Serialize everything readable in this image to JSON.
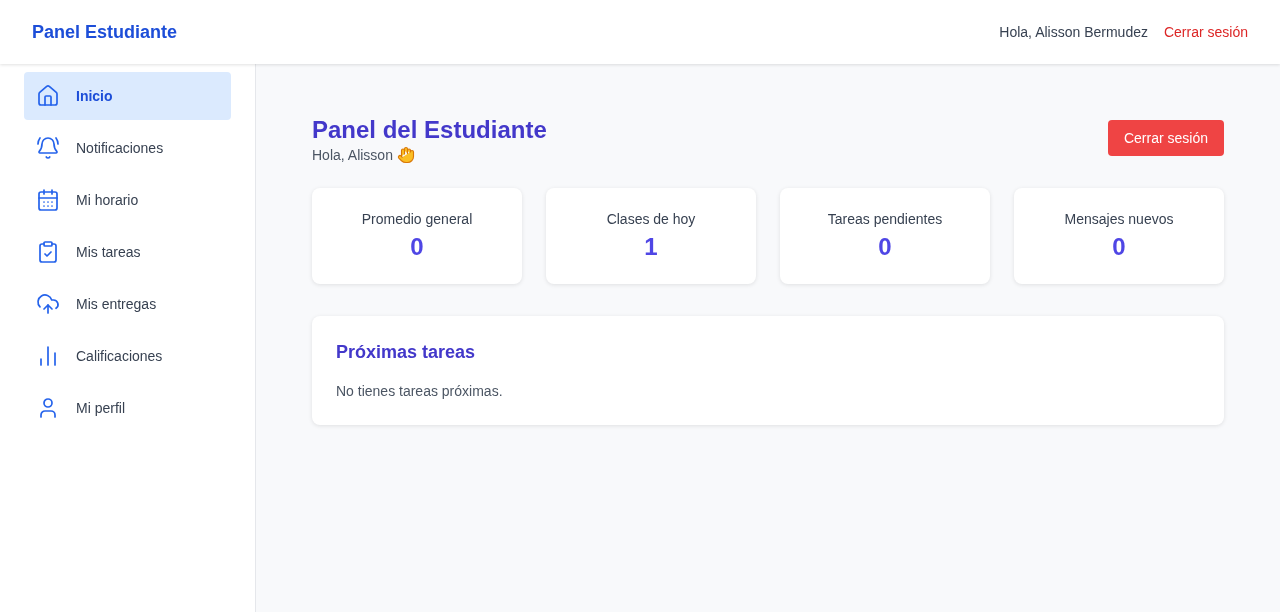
{
  "header": {
    "brand": "Panel Estudiante",
    "greeting": "Hola, Alisson Bermudez",
    "logout": "Cerrar sesión"
  },
  "sidebar": {
    "items": [
      {
        "label": "Inicio",
        "selected": true
      },
      {
        "label": "Notificaciones",
        "selected": false
      },
      {
        "label": "Mi horario",
        "selected": false
      },
      {
        "label": "Mis tareas",
        "selected": false
      },
      {
        "label": "Mis entregas",
        "selected": false
      },
      {
        "label": "Calificaciones",
        "selected": false
      },
      {
        "label": "Mi perfil",
        "selected": false
      }
    ]
  },
  "main": {
    "title": "Panel del Estudiante",
    "greeting": "Hola, Alisson",
    "logout_button": "Cerrar sesión",
    "stats": [
      {
        "label": "Promedio general",
        "value": "0"
      },
      {
        "label": "Clases de hoy",
        "value": "1"
      },
      {
        "label": "Tareas pendientes",
        "value": "0"
      },
      {
        "label": "Mensajes nuevos",
        "value": "0"
      }
    ],
    "upcoming": {
      "title": "Próximas tareas",
      "empty": "No tienes tareas próximas."
    }
  }
}
